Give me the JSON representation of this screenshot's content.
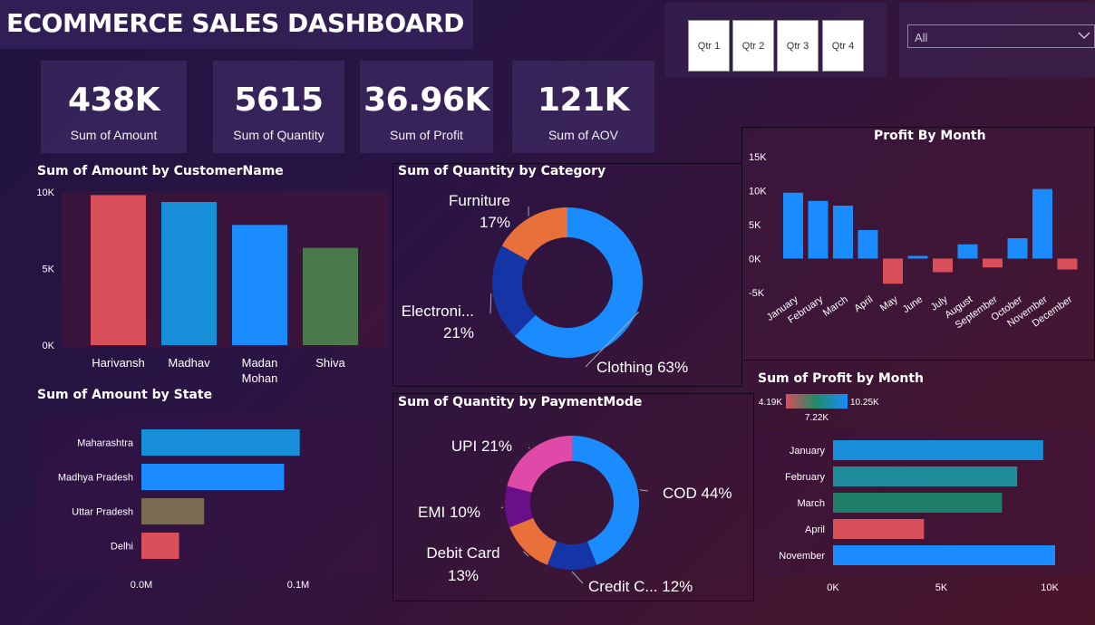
{
  "header": {
    "title": "ECOMMERCE SALES DASHBOARD"
  },
  "slicers": {
    "quarters": [
      "Qtr 1",
      "Qtr 2",
      "Qtr 3",
      "Qtr 4"
    ],
    "state_value": "All"
  },
  "kpis": [
    {
      "value": "438K",
      "label": "Sum of Amount"
    },
    {
      "value": "5615",
      "label": "Sum of Quantity"
    },
    {
      "value": "36.96K",
      "label": "Sum of Profit"
    },
    {
      "value": "121K",
      "label": "Sum of AOV"
    }
  ],
  "chart_data": [
    {
      "id": "amount_by_customer",
      "type": "bar",
      "title": "Sum of Amount by CustomerName",
      "categories": [
        "Harivansh",
        "Madhav",
        "Madan Mohan",
        "Shiva"
      ],
      "values": [
        9800,
        9350,
        7850,
        6350
      ],
      "colors": [
        "#d84f5a",
        "#168ed8",
        "#1a8cff",
        "#4a7a4c"
      ],
      "yticks": [
        "0K",
        "5K",
        "10K"
      ],
      "ylim": [
        0,
        10000
      ]
    },
    {
      "id": "quantity_by_category",
      "type": "pie",
      "title": "Sum of Quantity by Category",
      "slices": [
        {
          "label": "Clothing 63%",
          "value": 63,
          "color": "#1a8cff"
        },
        {
          "label": "Electroni... 21%",
          "value": 21,
          "color": "#1534a6"
        },
        {
          "label": "Furniture 17%",
          "value": 17,
          "color": "#e8703a"
        }
      ]
    },
    {
      "id": "profit_by_month",
      "type": "bar",
      "title": "Profit By Month",
      "categories": [
        "January",
        "February",
        "March",
        "April",
        "May",
        "June",
        "July",
        "August",
        "September",
        "October",
        "November",
        "December"
      ],
      "values": [
        9700,
        8500,
        7800,
        4200,
        -3700,
        400,
        -2000,
        2100,
        -1300,
        3000,
        10250,
        -1600
      ],
      "positive_color": "#1a8cff",
      "negative_color": "#d84f5a",
      "yticks": [
        "-5K",
        "0K",
        "5K",
        "10K",
        "15K"
      ],
      "ylim": [
        -5000,
        15000
      ]
    },
    {
      "id": "amount_by_state",
      "type": "bar",
      "title": "Sum of Amount by State",
      "categories": [
        "Maharashtra",
        "Madhya Pradesh",
        "Uttar Pradesh",
        "Delhi"
      ],
      "values": [
        101000,
        91000,
        40000,
        24000
      ],
      "colors": [
        "#168ed8",
        "#1a8cff",
        "#7a6a54",
        "#d84f5a"
      ],
      "xticks": [
        "0.0M",
        "0.1M"
      ],
      "xlim": [
        0,
        100000
      ]
    },
    {
      "id": "quantity_by_payment",
      "type": "pie",
      "title": "Sum of Quantity by PaymentMode",
      "slices": [
        {
          "label": "COD 44%",
          "value": 44,
          "color": "#1a8cff"
        },
        {
          "label": "Credit C... 12%",
          "value": 12,
          "color": "#1534a6"
        },
        {
          "label": "Debit Card 13%",
          "value": 13,
          "color": "#e8703a"
        },
        {
          "label": "EMI 10%",
          "value": 10,
          "color": "#6a0f8a"
        },
        {
          "label": "UPI 21%",
          "value": 21,
          "color": "#df4aa8"
        }
      ]
    },
    {
      "id": "profit_by_month_sum",
      "type": "bar",
      "title": "Sum of Profit by Month",
      "categories": [
        "January",
        "February",
        "March",
        "April",
        "November"
      ],
      "values": [
        9700,
        8500,
        7800,
        4200,
        10250
      ],
      "colors": [
        "#168ed8",
        "#1e8c9a",
        "#1e7e6a",
        "#d84f5a",
        "#1a8cff"
      ],
      "legend": {
        "min": "4.19K",
        "mid": "7.22K",
        "max": "10.25K"
      },
      "xticks": [
        "0K",
        "5K",
        "10K"
      ],
      "xlim": [
        0,
        10000
      ]
    }
  ]
}
